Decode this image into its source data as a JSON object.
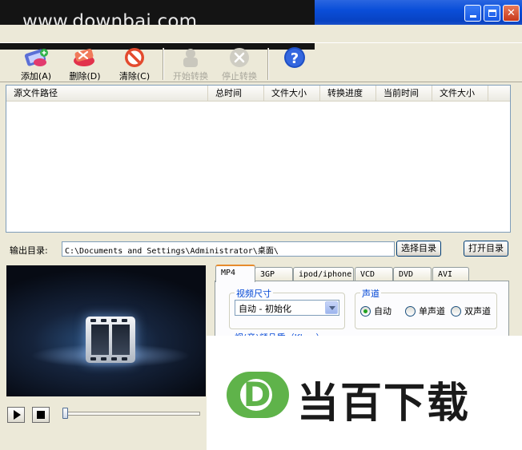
{
  "watermark": {
    "text": "www.downbai.com"
  },
  "toolbar": {
    "items": [
      {
        "label": "添加(A)",
        "icon": "add-file-icon",
        "enabled": true
      },
      {
        "label": "删除(D)",
        "icon": "delete-file-icon",
        "enabled": true
      },
      {
        "label": "清除(C)",
        "icon": "clear-icon",
        "enabled": true
      },
      {
        "label": "开始转换",
        "icon": "start-convert-icon",
        "enabled": false
      },
      {
        "label": "停止转换",
        "icon": "stop-convert-icon",
        "enabled": false
      },
      {
        "label": "",
        "icon": "help-icon",
        "enabled": true
      }
    ]
  },
  "filelist": {
    "columns": [
      "源文件路径",
      "总时间",
      "文件大小",
      "转换进度",
      "当前时间",
      "文件大小"
    ]
  },
  "output": {
    "label": "输出目录:",
    "path": "C:\\Documents and Settings\\Administrator\\桌面\\",
    "browse_label": "选择目录",
    "open_label": "打开目录"
  },
  "tabs": [
    {
      "label": "MP4",
      "active": true
    },
    {
      "label": "3GP",
      "active": false
    },
    {
      "label": "ipod/iphone",
      "active": false
    },
    {
      "label": "VCD",
      "active": false
    },
    {
      "label": "DVD",
      "active": false
    },
    {
      "label": "AVI",
      "active": false
    }
  ],
  "video_size": {
    "title": "视频尺寸",
    "value": "自动 - 初始化"
  },
  "audio_channel": {
    "title": "声道",
    "options": [
      {
        "label": "自动",
        "checked": true
      },
      {
        "label": "单声道",
        "checked": false
      },
      {
        "label": "双声道",
        "checked": false
      }
    ]
  },
  "partial_label": "视(音)频品质（Kbps）",
  "playback": {
    "position": 0
  },
  "brand": {
    "letter": "D",
    "text": "当百下载"
  },
  "colors": {
    "accent": "#5fb34a",
    "titlebar": "#0a4ed9",
    "group_title": "#0046d5"
  }
}
